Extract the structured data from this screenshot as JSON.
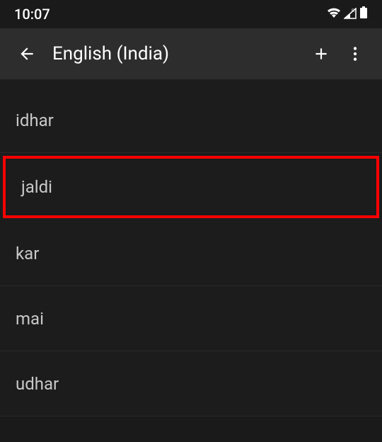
{
  "statusBar": {
    "time": "10:07"
  },
  "appBar": {
    "title": "English (India)"
  },
  "dictionary": {
    "items": [
      {
        "word": "idhar",
        "highlighted": false
      },
      {
        "word": "jaldi",
        "highlighted": true
      },
      {
        "word": "kar",
        "highlighted": false
      },
      {
        "word": "mai",
        "highlighted": false
      },
      {
        "word": "udhar",
        "highlighted": false
      }
    ]
  }
}
